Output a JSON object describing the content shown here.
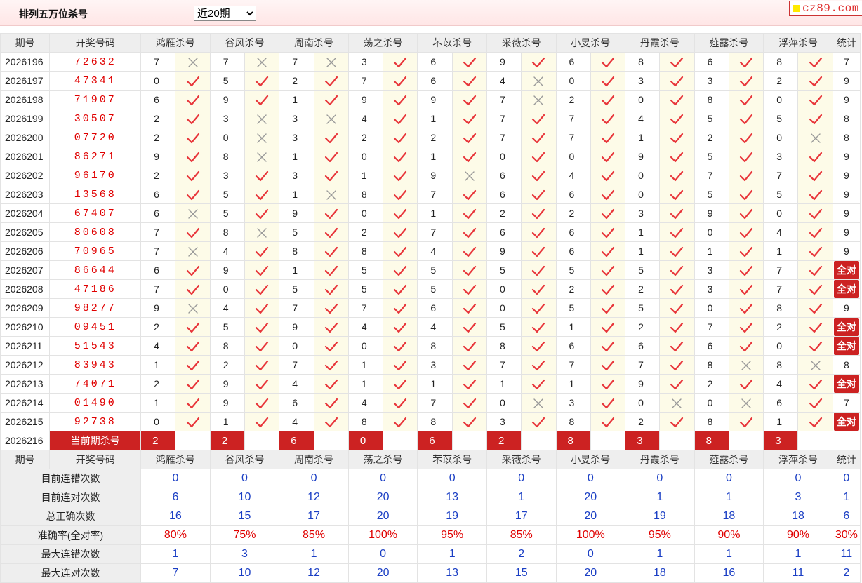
{
  "header": {
    "title": "排列五万位杀号",
    "period_select": "近20期"
  },
  "logo": {
    "text": "cz89.com"
  },
  "colors": {
    "accent_red": "#cc2222",
    "number_red": "#e00000",
    "stat_blue": "#1a3ec4",
    "tick_red": "#e8353a",
    "cross_gray": "#9a9a9a"
  },
  "table": {
    "columns": [
      "期号",
      "开奖号码",
      "鸿雁杀号",
      "谷风杀号",
      "周南杀号",
      "荡之杀号",
      "芣苡杀号",
      "采薇杀号",
      "小旻杀号",
      "丹霞杀号",
      "薤露杀号",
      "浮萍杀号",
      "统计"
    ],
    "rows": [
      {
        "issue": "2026196",
        "win": "72632",
        "kills": [
          "7",
          "7",
          "7",
          "3",
          "6",
          "9",
          "6",
          "8",
          "6",
          "8"
        ],
        "hits": [
          0,
          0,
          0,
          1,
          1,
          1,
          1,
          1,
          1,
          1
        ],
        "stat": "7"
      },
      {
        "issue": "2026197",
        "win": "47341",
        "kills": [
          "0",
          "5",
          "2",
          "7",
          "6",
          "4",
          "0",
          "3",
          "3",
          "2"
        ],
        "hits": [
          1,
          1,
          1,
          1,
          1,
          0,
          1,
          1,
          1,
          1
        ],
        "stat": "9"
      },
      {
        "issue": "2026198",
        "win": "71907",
        "kills": [
          "6",
          "9",
          "1",
          "9",
          "9",
          "7",
          "2",
          "0",
          "8",
          "0"
        ],
        "hits": [
          1,
          1,
          1,
          1,
          1,
          0,
          1,
          1,
          1,
          1
        ],
        "stat": "9"
      },
      {
        "issue": "2026199",
        "win": "30507",
        "kills": [
          "2",
          "3",
          "3",
          "4",
          "1",
          "7",
          "7",
          "4",
          "5",
          "5"
        ],
        "hits": [
          1,
          0,
          0,
          1,
          1,
          1,
          1,
          1,
          1,
          1
        ],
        "stat": "8"
      },
      {
        "issue": "2026200",
        "win": "07720",
        "kills": [
          "2",
          "0",
          "3",
          "2",
          "2",
          "7",
          "7",
          "1",
          "2",
          "0"
        ],
        "hits": [
          1,
          0,
          1,
          1,
          1,
          1,
          1,
          1,
          1,
          0
        ],
        "stat": "8"
      },
      {
        "issue": "2026201",
        "win": "86271",
        "kills": [
          "9",
          "8",
          "1",
          "0",
          "1",
          "0",
          "0",
          "9",
          "5",
          "3"
        ],
        "hits": [
          1,
          0,
          1,
          1,
          1,
          1,
          1,
          1,
          1,
          1
        ],
        "stat": "9"
      },
      {
        "issue": "2026202",
        "win": "96170",
        "kills": [
          "2",
          "3",
          "3",
          "1",
          "9",
          "6",
          "4",
          "0",
          "7",
          "7"
        ],
        "hits": [
          1,
          1,
          1,
          1,
          0,
          1,
          1,
          1,
          1,
          1
        ],
        "stat": "9"
      },
      {
        "issue": "2026203",
        "win": "13568",
        "kills": [
          "6",
          "5",
          "1",
          "8",
          "7",
          "6",
          "6",
          "0",
          "5",
          "5"
        ],
        "hits": [
          1,
          1,
          0,
          1,
          1,
          1,
          1,
          1,
          1,
          1
        ],
        "stat": "9"
      },
      {
        "issue": "2026204",
        "win": "67407",
        "kills": [
          "6",
          "5",
          "9",
          "0",
          "1",
          "2",
          "2",
          "3",
          "9",
          "0"
        ],
        "hits": [
          0,
          1,
          1,
          1,
          1,
          1,
          1,
          1,
          1,
          1
        ],
        "stat": "9"
      },
      {
        "issue": "2026205",
        "win": "80608",
        "kills": [
          "7",
          "8",
          "5",
          "2",
          "7",
          "6",
          "6",
          "1",
          "0",
          "4"
        ],
        "hits": [
          1,
          0,
          1,
          1,
          1,
          1,
          1,
          1,
          1,
          1
        ],
        "stat": "9"
      },
      {
        "issue": "2026206",
        "win": "70965",
        "kills": [
          "7",
          "4",
          "8",
          "8",
          "4",
          "9",
          "6",
          "1",
          "1",
          "1"
        ],
        "hits": [
          0,
          1,
          1,
          1,
          1,
          1,
          1,
          1,
          1,
          1
        ],
        "stat": "9"
      },
      {
        "issue": "2026207",
        "win": "86644",
        "kills": [
          "6",
          "9",
          "1",
          "5",
          "5",
          "5",
          "5",
          "5",
          "3",
          "7"
        ],
        "hits": [
          1,
          1,
          1,
          1,
          1,
          1,
          1,
          1,
          1,
          1
        ],
        "stat": "全对"
      },
      {
        "issue": "2026208",
        "win": "47186",
        "kills": [
          "7",
          "0",
          "5",
          "5",
          "5",
          "0",
          "2",
          "2",
          "3",
          "7"
        ],
        "hits": [
          1,
          1,
          1,
          1,
          1,
          1,
          1,
          1,
          1,
          1
        ],
        "stat": "全对"
      },
      {
        "issue": "2026209",
        "win": "98277",
        "kills": [
          "9",
          "4",
          "7",
          "7",
          "6",
          "0",
          "5",
          "5",
          "0",
          "8"
        ],
        "hits": [
          0,
          1,
          1,
          1,
          1,
          1,
          1,
          1,
          1,
          1
        ],
        "stat": "9"
      },
      {
        "issue": "2026210",
        "win": "09451",
        "kills": [
          "2",
          "5",
          "9",
          "4",
          "4",
          "5",
          "1",
          "2",
          "7",
          "2"
        ],
        "hits": [
          1,
          1,
          1,
          1,
          1,
          1,
          1,
          1,
          1,
          1
        ],
        "stat": "全对"
      },
      {
        "issue": "2026211",
        "win": "51543",
        "kills": [
          "4",
          "8",
          "0",
          "0",
          "8",
          "8",
          "6",
          "6",
          "6",
          "0"
        ],
        "hits": [
          1,
          1,
          1,
          1,
          1,
          1,
          1,
          1,
          1,
          1
        ],
        "stat": "全对"
      },
      {
        "issue": "2026212",
        "win": "83943",
        "kills": [
          "1",
          "2",
          "7",
          "1",
          "3",
          "7",
          "7",
          "7",
          "8",
          "8"
        ],
        "hits": [
          1,
          1,
          1,
          1,
          1,
          1,
          1,
          1,
          0,
          0
        ],
        "stat": "8"
      },
      {
        "issue": "2026213",
        "win": "74071",
        "kills": [
          "2",
          "9",
          "4",
          "1",
          "1",
          "1",
          "1",
          "9",
          "2",
          "4"
        ],
        "hits": [
          1,
          1,
          1,
          1,
          1,
          1,
          1,
          1,
          1,
          1
        ],
        "stat": "全对"
      },
      {
        "issue": "2026214",
        "win": "01490",
        "kills": [
          "1",
          "9",
          "6",
          "4",
          "7",
          "0",
          "3",
          "0",
          "0",
          "6"
        ],
        "hits": [
          1,
          1,
          1,
          1,
          1,
          0,
          1,
          0,
          0,
          1
        ],
        "stat": "7"
      },
      {
        "issue": "2026215",
        "win": "92738",
        "kills": [
          "0",
          "1",
          "4",
          "8",
          "8",
          "3",
          "8",
          "2",
          "8",
          "1"
        ],
        "hits": [
          1,
          1,
          1,
          1,
          1,
          1,
          1,
          1,
          1,
          1
        ],
        "stat": "全对"
      }
    ],
    "current": {
      "issue": "2026216",
      "label": "当前期杀号",
      "kills": [
        "2",
        "2",
        "6",
        "0",
        "6",
        "2",
        "8",
        "3",
        "8",
        "3"
      ]
    }
  },
  "summary": {
    "columns": [
      "期号",
      "开奖号码",
      "鸿雁杀号",
      "谷风杀号",
      "周南杀号",
      "荡之杀号",
      "芣苡杀号",
      "采薇杀号",
      "小旻杀号",
      "丹霞杀号",
      "薤露杀号",
      "浮萍杀号",
      "统计"
    ],
    "rows": [
      {
        "label": "目前连错次数",
        "values": [
          "0",
          "0",
          "0",
          "0",
          "0",
          "0",
          "0",
          "0",
          "0",
          "0",
          "0"
        ]
      },
      {
        "label": "目前连对次数",
        "values": [
          "6",
          "10",
          "12",
          "20",
          "13",
          "1",
          "20",
          "1",
          "1",
          "3",
          "1"
        ]
      },
      {
        "label": "总正确次数",
        "values": [
          "16",
          "15",
          "17",
          "20",
          "19",
          "17",
          "20",
          "19",
          "18",
          "18",
          "6"
        ]
      },
      {
        "label": "准确率(全对率)",
        "values": [
          "80%",
          "75%",
          "85%",
          "100%",
          "95%",
          "85%",
          "100%",
          "95%",
          "90%",
          "90%",
          "30%"
        ],
        "is_pct": true
      },
      {
        "label": "最大连错次数",
        "values": [
          "1",
          "3",
          "1",
          "0",
          "1",
          "2",
          "0",
          "1",
          "1",
          "1",
          "11"
        ]
      },
      {
        "label": "最大连对次数",
        "values": [
          "7",
          "10",
          "12",
          "20",
          "13",
          "15",
          "20",
          "18",
          "16",
          "11",
          "2"
        ]
      }
    ]
  }
}
